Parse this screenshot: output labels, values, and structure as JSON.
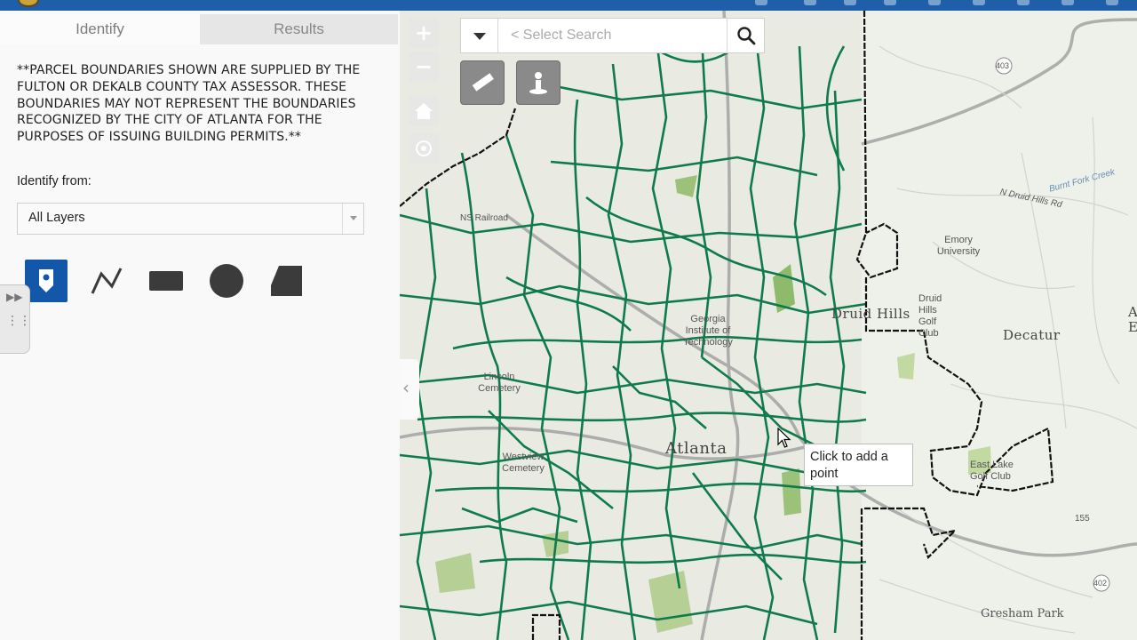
{
  "tabs": {
    "identify": "Identify",
    "results": "Results"
  },
  "notice": "**PARCEL BOUNDARIES SHOWN ARE SUPPLIED BY THE FULTON OR DEKALB COUNTY TAX ASSESSOR. THESE BOUNDARIES MAY NOT REPRESENT THE BOUNDARIES RECOGNIZED BY THE CITY OF ATLANTA FOR THE PURPOSES OF ISSUING BUILDING PERMITS.**",
  "identify_from": {
    "label": "Identify from:",
    "selected": "All Layers"
  },
  "draw_tools": [
    {
      "name": "point",
      "icon": "map-pin-icon",
      "active": true
    },
    {
      "name": "polyline",
      "icon": "polyline-icon",
      "active": false
    },
    {
      "name": "extent",
      "icon": "rectangle-icon",
      "active": false
    },
    {
      "name": "circle",
      "icon": "circle-icon",
      "active": false
    },
    {
      "name": "polygon",
      "icon": "polygon-icon",
      "active": false
    }
  ],
  "search": {
    "placeholder": "< Select Search"
  },
  "tooltip": {
    "text": "Click to add a point"
  },
  "map_labels": {
    "druid_hills": "Druid Hills",
    "decatur": "Decatur",
    "emory": "Emory University",
    "druid_hills_gc": "Druid Hills Golf Club",
    "georgia_tech": "Georgia Institute of Technology",
    "lincoln": "Lincoln Cemetery",
    "westview": "Westview Cemetery",
    "atlanta": "Atlanta",
    "east_lake": "East Lake Golf Club",
    "gresham": "Gresham Park",
    "n_druid_hills": "N Druid Hills Rd",
    "burnt_fork": "Burnt Fork Creek",
    "av": "Av",
    "e": "E",
    "rt_403": "403",
    "rt_402": "402",
    "rt_155": "155",
    "ns_railroad": "NS Railroad"
  },
  "colors": {
    "topbar": "#1f5ea8",
    "active_tool": "#1358a8",
    "parcel_lines": "#0f7a4a",
    "city_boundary": "#111111"
  }
}
